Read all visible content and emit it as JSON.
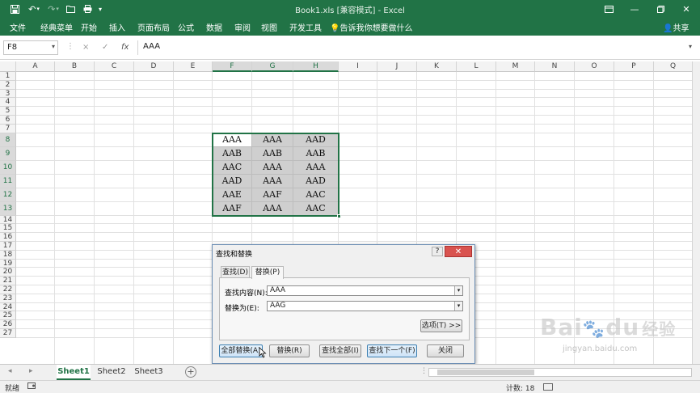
{
  "titlebar": {
    "title": "Book1.xls  [兼容模式]  -  Excel",
    "qa_icons": [
      "save-icon",
      "undo-icon",
      "redo-icon",
      "open-icon",
      "customize-icon"
    ],
    "window_controls": [
      "restore-ribbon",
      "minimize",
      "maximize",
      "close"
    ]
  },
  "ribbon": {
    "tabs": [
      "文件",
      "经典菜单",
      "开始",
      "插入",
      "页面布局",
      "公式",
      "数据",
      "审阅",
      "视图",
      "开发工具"
    ],
    "tellme": "告诉我你想要做什么",
    "share": "共享"
  },
  "formulabar": {
    "namebox": "F8",
    "cancel": "×",
    "enter": "✓",
    "fx": "fx",
    "value": "AAA"
  },
  "grid": {
    "columns": [
      "A",
      "B",
      "C",
      "D",
      "E",
      "F",
      "G",
      "H",
      "I",
      "J",
      "K",
      "L",
      "M",
      "N",
      "O",
      "P",
      "Q"
    ],
    "selected_columns": [
      "F",
      "G",
      "H"
    ],
    "rows": [
      "1",
      "2",
      "3",
      "4",
      "5",
      "6",
      "7",
      "8",
      "9",
      "10",
      "11",
      "12",
      "13",
      "14",
      "15",
      "16",
      "17",
      "18",
      "19",
      "20",
      "21",
      "22",
      "23",
      "24",
      "25",
      "26",
      "27"
    ],
    "selected_rows": [
      "8",
      "9",
      "10",
      "11",
      "12",
      "13"
    ],
    "active_cell": "F8",
    "cells": [
      [
        "AAA",
        "AAA",
        "AAD"
      ],
      [
        "AAB",
        "AAB",
        "AAB"
      ],
      [
        "AAC",
        "AAA",
        "AAA"
      ],
      [
        "AAD",
        "AAA",
        "AAD"
      ],
      [
        "AAE",
        "AAF",
        "AAC"
      ],
      [
        "AAF",
        "AAA",
        "AAC"
      ]
    ]
  },
  "dialog": {
    "title": "查找和替换",
    "help": "?",
    "close": "✕",
    "tabs": [
      "查找(D)",
      "替换(P)"
    ],
    "active_tab": "替换(P)",
    "find_label": "查找内容(N):",
    "find_value": "AAA",
    "replace_label": "替换为(E):",
    "replace_value": "AAG",
    "options_button": "选项(T) >>",
    "buttons": {
      "replace_all": "全部替换(A)",
      "replace": "替换(R)",
      "find_all": "查找全部(I)",
      "find_next": "查找下一个(F)",
      "close": "关闭"
    }
  },
  "sheets": {
    "tabs": [
      "Sheet1",
      "Sheet2",
      "Sheet3"
    ],
    "active": "Sheet1",
    "add": "+"
  },
  "status": {
    "mode": "就绪",
    "count": "计数: 18"
  },
  "watermark": {
    "brand": "Bai",
    "brand2": "du",
    "sub": "经验",
    "url": "jingyan.baidu.com"
  },
  "colors": {
    "excel_green": "#217346",
    "selection_fill": "#cfcfcf",
    "dialog_bg": "#f0f0f0"
  }
}
